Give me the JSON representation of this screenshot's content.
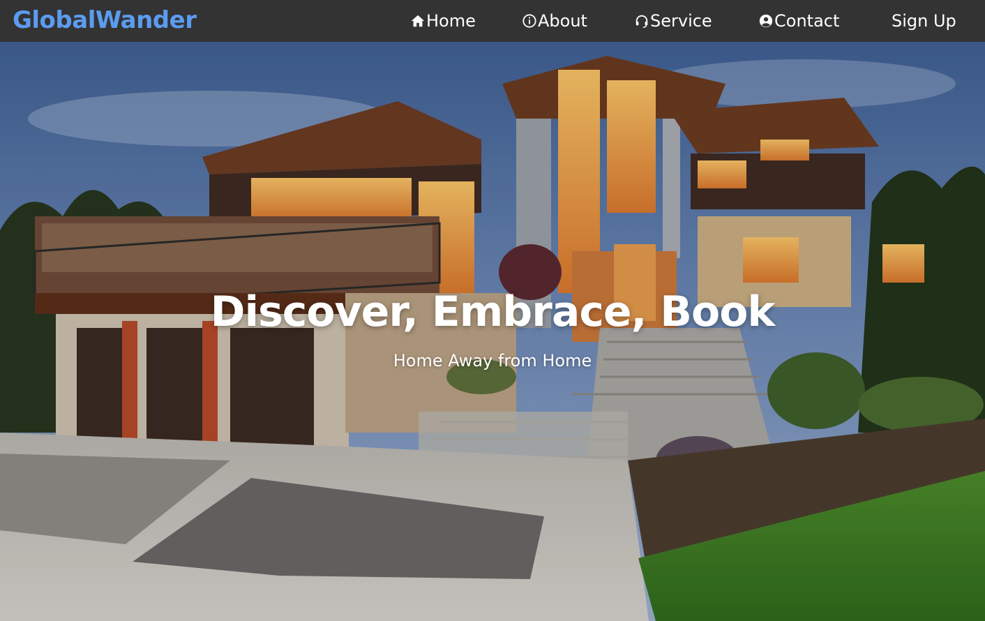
{
  "brand": {
    "name": "GlobalWander",
    "color": "#5b9cf0"
  },
  "nav": {
    "items": [
      {
        "label": "Home",
        "icon": "home-icon"
      },
      {
        "label": "About",
        "icon": "info-icon"
      },
      {
        "label": "Service",
        "icon": "headset-icon"
      },
      {
        "label": "Contact",
        "icon": "user-circle-icon"
      }
    ],
    "signup_label": "Sign Up",
    "background": "#333333"
  },
  "hero": {
    "title": "Discover, Embrace, Book",
    "subtitle": "Home Away from Home",
    "image": "modern-house-dusk-photo"
  }
}
